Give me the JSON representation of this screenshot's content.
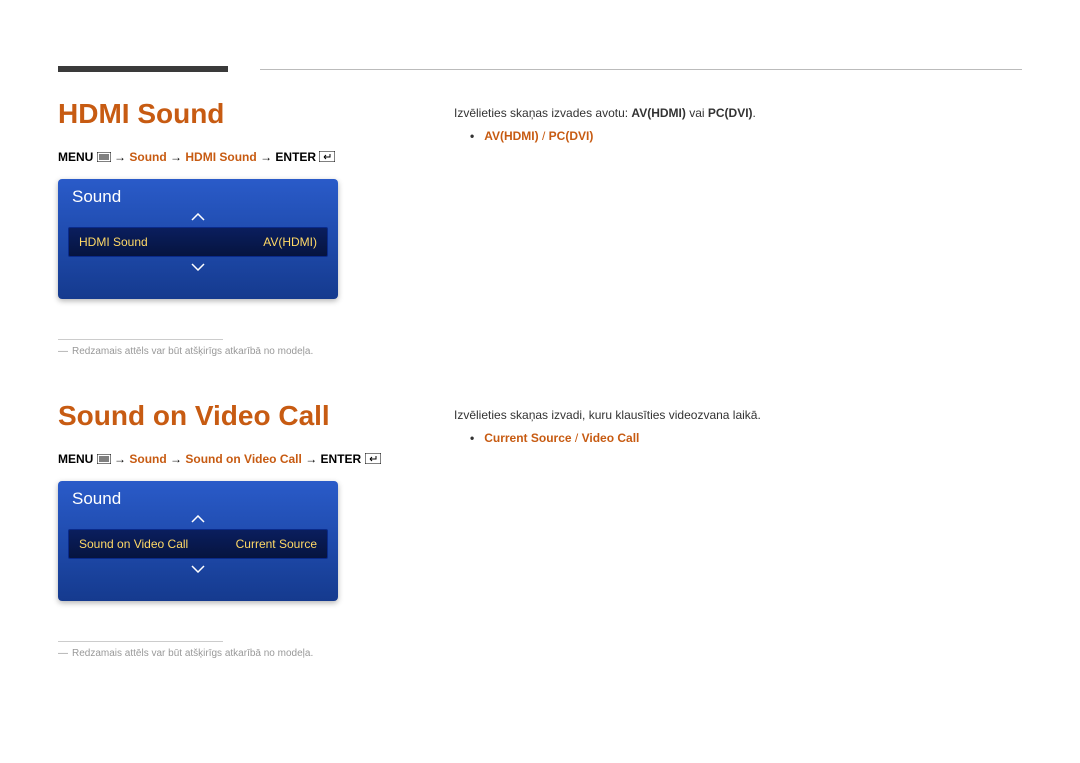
{
  "section1": {
    "title": "HDMI Sound",
    "path": {
      "menu": "MENU",
      "p1": "Sound",
      "p2": "HDMI Sound",
      "enter": "ENTER"
    },
    "panel": {
      "title": "Sound",
      "row_label": "HDMI Sound",
      "row_value": "AV(HDMI)"
    },
    "footnote": "Redzamais attēls var būt atšķirīgs atkarībā no modeļa."
  },
  "section2": {
    "title": "Sound on Video Call",
    "path": {
      "menu": "MENU",
      "p1": "Sound",
      "p2": "Sound on Video Call",
      "enter": "ENTER"
    },
    "panel": {
      "title": "Sound",
      "row_label": "Sound on Video Call",
      "row_value": "Current Source"
    },
    "footnote": "Redzamais attēls var būt atšķirīgs atkarībā no modeļa."
  },
  "right1": {
    "text_pre": "Izvēlieties skaņas izvades avotu: ",
    "bold1": "AV(HDMI)",
    "mid": " vai ",
    "bold2": "PC(DVI)",
    "suffix": ".",
    "bullet_a": "AV(HDMI)",
    "bullet_sep": " / ",
    "bullet_b": "PC(DVI)"
  },
  "right2": {
    "text": "Izvēlieties skaņas izvadi, kuru klausīties videozvana laikā.",
    "bullet_a": "Current Source",
    "bullet_sep": " / ",
    "bullet_b": "Video Call"
  },
  "arrows": "→"
}
